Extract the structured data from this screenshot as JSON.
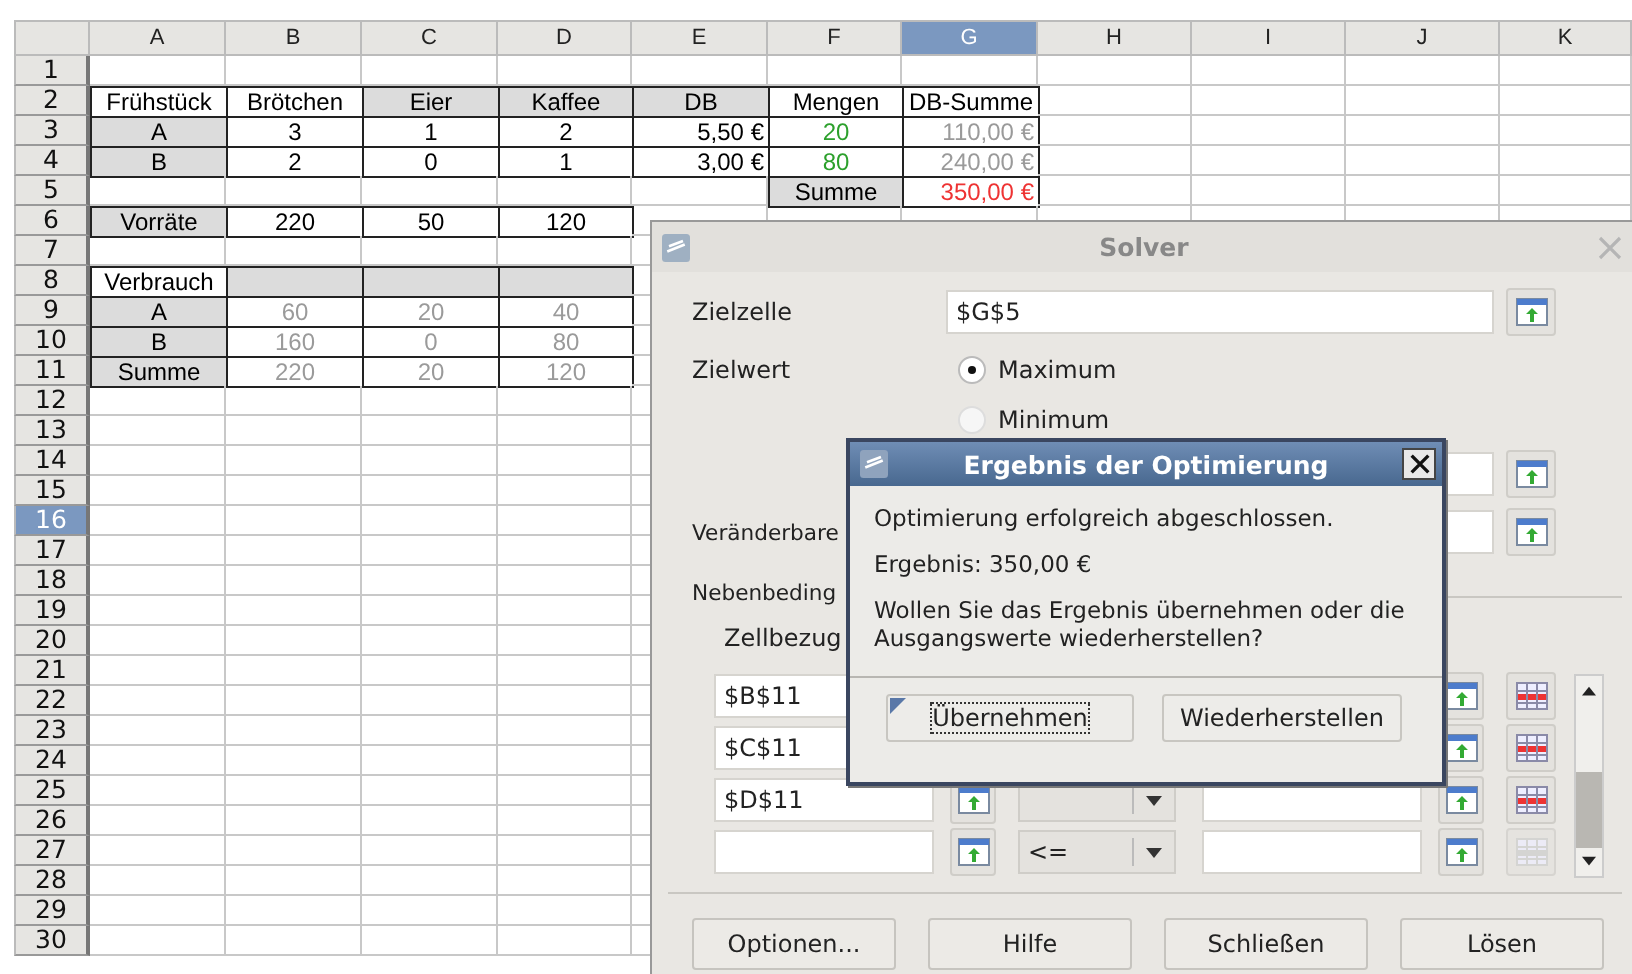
{
  "sheet": {
    "columns": [
      {
        "label": "A",
        "selected": false
      },
      {
        "label": "B",
        "selected": false
      },
      {
        "label": "C",
        "selected": false
      },
      {
        "label": "D",
        "selected": false
      },
      {
        "label": "E",
        "selected": false
      },
      {
        "label": "F",
        "selected": false
      },
      {
        "label": "G",
        "selected": true
      },
      {
        "label": "H",
        "selected": false
      },
      {
        "label": "I",
        "selected": false
      },
      {
        "label": "J",
        "selected": false
      },
      {
        "label": "K",
        "selected": false
      }
    ],
    "rows": [
      {
        "header": "1",
        "selected": false
      },
      {
        "header": "2",
        "selected": false,
        "cells": [
          {
            "kind": "text",
            "text": "Frühstück",
            "shaded": false
          },
          {
            "kind": "text",
            "text": "Brötchen",
            "shaded": false
          },
          {
            "kind": "text",
            "text": "Eier",
            "shaded": true
          },
          {
            "kind": "text",
            "text": "Kaffee",
            "shaded": true
          },
          {
            "kind": "text",
            "text": "DB",
            "shaded": true
          },
          {
            "kind": "text",
            "text": "Mengen",
            "shaded": false
          },
          {
            "kind": "text",
            "text": "DB-Summe",
            "shaded": false
          }
        ]
      },
      {
        "header": "3",
        "selected": false,
        "cells": [
          {
            "kind": "text",
            "text": "A",
            "shaded": true
          },
          {
            "kind": "text",
            "text": "3",
            "shaded": false
          },
          {
            "kind": "text",
            "text": "1",
            "shaded": false
          },
          {
            "kind": "text",
            "text": "2",
            "shaded": false
          },
          {
            "kind": "currency",
            "text": "5,50 €",
            "shaded": false
          },
          {
            "kind": "text",
            "text": "20",
            "shaded": false,
            "color": "#2ca02c"
          },
          {
            "kind": "currency",
            "text": "110,00 €",
            "shaded": false,
            "color": "#9a9a9a"
          }
        ]
      },
      {
        "header": "4",
        "selected": false,
        "cells": [
          {
            "kind": "text",
            "text": "B",
            "shaded": true
          },
          {
            "kind": "text",
            "text": "2",
            "shaded": false
          },
          {
            "kind": "text",
            "text": "0",
            "shaded": false
          },
          {
            "kind": "text",
            "text": "1",
            "shaded": false
          },
          {
            "kind": "currency",
            "text": "3,00 €",
            "shaded": false
          },
          {
            "kind": "text",
            "text": "80",
            "shaded": false,
            "color": "#2ca02c"
          },
          {
            "kind": "currency",
            "text": "240,00 €",
            "shaded": false,
            "color": "#9a9a9a"
          }
        ]
      },
      {
        "header": "5",
        "selected": false,
        "cells": [
          {
            "kind": "empty",
            "shaded": false
          },
          {
            "kind": "empty",
            "shaded": false
          },
          {
            "kind": "empty",
            "shaded": false
          },
          {
            "kind": "empty",
            "shaded": false
          },
          {
            "kind": "empty",
            "shaded": false
          },
          {
            "kind": "text",
            "text": "Summe",
            "shaded": true
          },
          {
            "kind": "currency",
            "text": "350,00 €",
            "shaded": false,
            "color": "#ee3333"
          }
        ]
      },
      {
        "header": "6",
        "selected": false,
        "cells": [
          {
            "kind": "text",
            "text": "Vorräte",
            "shaded": true
          },
          {
            "kind": "text",
            "text": "220",
            "shaded": false
          },
          {
            "kind": "text",
            "text": "50",
            "shaded": false
          },
          {
            "kind": "text",
            "text": "120",
            "shaded": false
          }
        ]
      },
      {
        "header": "7",
        "selected": false
      },
      {
        "header": "8",
        "selected": false,
        "cells": [
          {
            "kind": "text",
            "text": "Verbrauch",
            "shaded": false
          },
          {
            "kind": "empty",
            "shaded": true
          },
          {
            "kind": "empty",
            "shaded": true
          },
          {
            "kind": "empty",
            "shaded": true
          }
        ]
      },
      {
        "header": "9",
        "selected": false,
        "cells": [
          {
            "kind": "text",
            "text": "A",
            "shaded": true
          },
          {
            "kind": "text",
            "text": "60",
            "shaded": false,
            "color": "#9a9a9a"
          },
          {
            "kind": "text",
            "text": "20",
            "shaded": false,
            "color": "#9a9a9a"
          },
          {
            "kind": "text",
            "text": "40",
            "shaded": false,
            "color": "#9a9a9a"
          }
        ]
      },
      {
        "header": "10",
        "selected": false,
        "cells": [
          {
            "kind": "text",
            "text": "B",
            "shaded": true
          },
          {
            "kind": "text",
            "text": "160",
            "shaded": false,
            "color": "#9a9a9a"
          },
          {
            "kind": "text",
            "text": "0",
            "shaded": false,
            "color": "#9a9a9a"
          },
          {
            "kind": "text",
            "text": "80",
            "shaded": false,
            "color": "#9a9a9a"
          }
        ]
      },
      {
        "header": "11",
        "selected": false,
        "cells": [
          {
            "kind": "text",
            "text": "Summe",
            "shaded": true
          },
          {
            "kind": "text",
            "text": "220",
            "shaded": false,
            "color": "#9a9a9a"
          },
          {
            "kind": "text",
            "text": "20",
            "shaded": false,
            "color": "#9a9a9a"
          },
          {
            "kind": "text",
            "text": "120",
            "shaded": false,
            "color": "#9a9a9a"
          }
        ]
      },
      {
        "header": "12",
        "selected": false
      },
      {
        "header": "13",
        "selected": false
      },
      {
        "header": "14",
        "selected": false
      },
      {
        "header": "15",
        "selected": false
      },
      {
        "header": "16",
        "selected": true
      },
      {
        "header": "17",
        "selected": false
      },
      {
        "header": "18",
        "selected": false
      },
      {
        "header": "19",
        "selected": false
      },
      {
        "header": "20",
        "selected": false
      },
      {
        "header": "21",
        "selected": false
      },
      {
        "header": "22",
        "selected": false
      },
      {
        "header": "23",
        "selected": false
      },
      {
        "header": "24",
        "selected": false
      },
      {
        "header": "25",
        "selected": false
      },
      {
        "header": "26",
        "selected": false
      },
      {
        "header": "27",
        "selected": false
      },
      {
        "header": "28",
        "selected": false
      },
      {
        "header": "29",
        "selected": false
      },
      {
        "header": "30",
        "selected": false
      }
    ]
  },
  "solver": {
    "title": "Solver",
    "target_label": "Zielzelle",
    "target_value": "$G$5",
    "goal_label": "Zielwert",
    "goal_options": [
      {
        "label": "Maximum",
        "selected": true
      },
      {
        "label": "Minimum",
        "selected": false
      }
    ],
    "variable_label": "Veränderbare",
    "constraints_label": "Nebenbeding",
    "cell_ref_label": "Zellbezug",
    "constraints": [
      {
        "cell": "$B$11",
        "delete_disabled": false
      },
      {
        "cell": "$C$11",
        "delete_disabled": false
      },
      {
        "cell": "$D$11",
        "delete_disabled": false
      },
      {
        "operator": "<=",
        "delete_disabled": true
      }
    ],
    "buttons": [
      "Optionen...",
      "Hilfe",
      "Schließen",
      "Lösen"
    ]
  },
  "result_dialog": {
    "title": "Ergebnis der Optimierung",
    "message": "Optimierung erfolgreich abgeschlossen.",
    "result": "Ergebnis: 350,00 €",
    "question": "Wollen Sie das Ergebnis übernehmen oder die Ausgangswerte wiederherstellen?",
    "buttons": [
      {
        "label": "Übernehmen",
        "focused": true
      },
      {
        "label": "Wiederherstellen",
        "focused": false
      }
    ]
  }
}
